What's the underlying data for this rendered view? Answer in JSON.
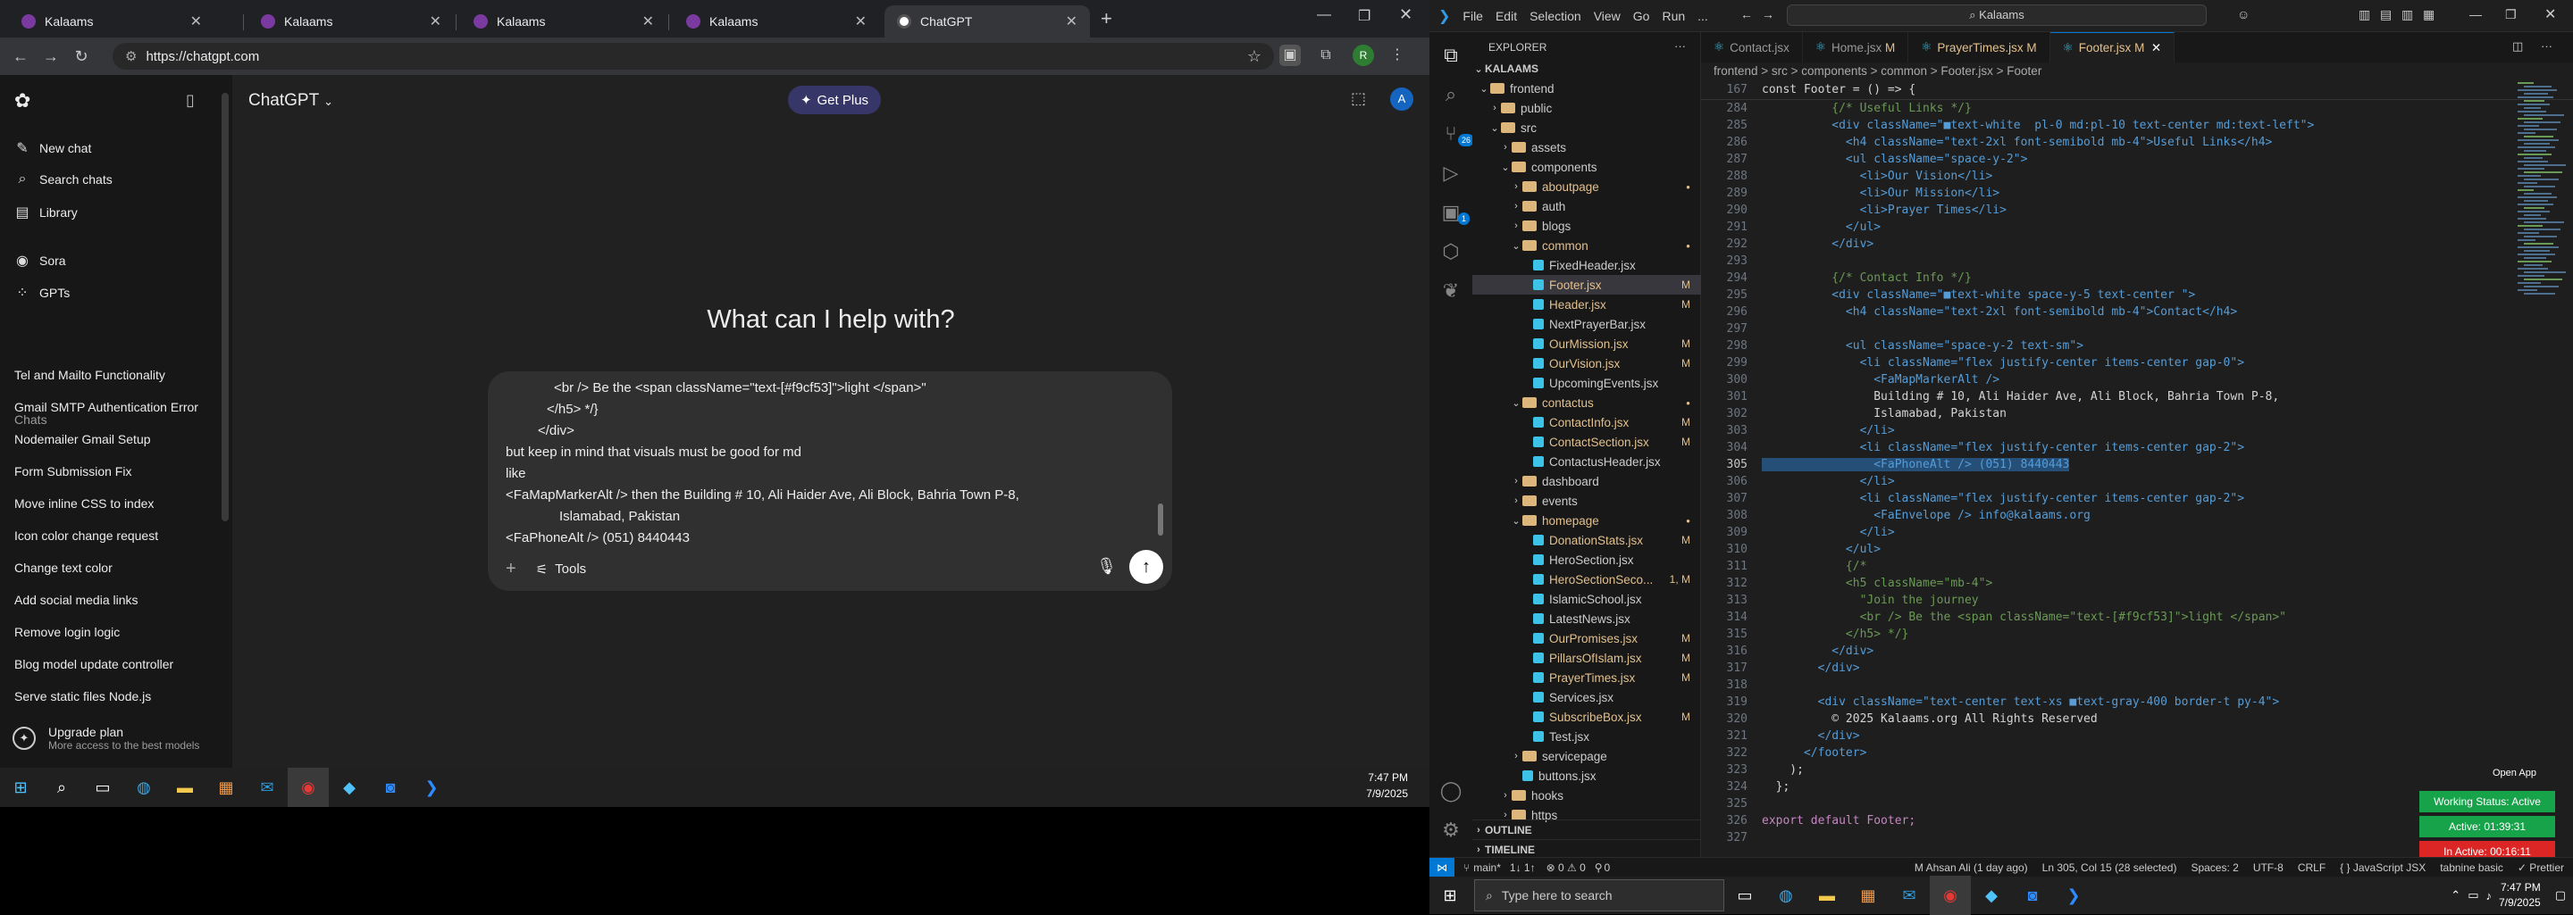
{
  "browser": {
    "tabs": [
      {
        "label": "Kalaams"
      },
      {
        "label": "Kalaams"
      },
      {
        "label": "Kalaams"
      },
      {
        "label": "Kalaams"
      },
      {
        "label": "ChatGPT"
      }
    ],
    "url": "https://chatgpt.com"
  },
  "gpt": {
    "title": "ChatGPT",
    "get_plus": "Get Plus",
    "nav": [
      {
        "label": "New chat",
        "icon": "new-chat-icon"
      },
      {
        "label": "Search chats",
        "icon": "search-icon"
      },
      {
        "label": "Library",
        "icon": "library-icon"
      },
      {
        "label": "Sora",
        "icon": "sora-icon"
      },
      {
        "label": "GPTs",
        "icon": "gpts-icon"
      }
    ],
    "chats_label": "Chats",
    "chats": [
      "Tel and Mailto Functionality",
      "Gmail SMTP Authentication Error",
      "Nodemailer Gmail Setup",
      "Form Submission Fix",
      "Move inline CSS to index",
      "Icon color change request",
      "Change text color",
      "Add social media links",
      "Remove login logic",
      "Blog model update controller",
      "Serve static files Node.js"
    ],
    "upgrade_title": "Upgrade plan",
    "upgrade_sub": "More access to the best models",
    "heading": "What can I help with?",
    "composer_lines": [
      "<br /> Be the <span className=\"text-[#f9cf53]\">light </span>\"",
      "</h5> */}",
      "</div>",
      "but keep in mind that visuals must be good for md",
      "like",
      "<FaMapMarkerAlt /> then the Building # 10, Ali Haider Ave, Ali Block, Bahria Town P-8,",
      "Islamabad, Pakistan",
      "<FaPhoneAlt /> (051) 8440443"
    ],
    "tools_label": "Tools"
  },
  "taskbar_left": {
    "time": "7:47 PM",
    "date": "7/9/2025"
  },
  "vscode": {
    "menu": [
      "File",
      "Edit",
      "Selection",
      "View",
      "Go",
      "Run",
      "..."
    ],
    "command_center": "Kalaams",
    "explorer_label": "EXPLORER",
    "workspace": "KALAAMS",
    "tree": [
      {
        "label": "frontend",
        "indent": 1,
        "type": "folder",
        "open": true
      },
      {
        "label": "public",
        "indent": 2,
        "type": "folder"
      },
      {
        "label": "src",
        "indent": 2,
        "type": "folder",
        "open": true
      },
      {
        "label": "assets",
        "indent": 3,
        "type": "folder"
      },
      {
        "label": "components",
        "indent": 3,
        "type": "folder",
        "open": true
      },
      {
        "label": "aboutpage",
        "indent": 4,
        "type": "folder",
        "mod": true
      },
      {
        "label": "auth",
        "indent": 4,
        "type": "folder"
      },
      {
        "label": "blogs",
        "indent": 4,
        "type": "folder"
      },
      {
        "label": "common",
        "indent": 4,
        "type": "folder",
        "open": true,
        "mod": true
      },
      {
        "label": "FixedHeader.jsx",
        "indent": 5,
        "type": "file"
      },
      {
        "label": "Footer.jsx",
        "indent": 5,
        "type": "file",
        "status": "M",
        "selected": true
      },
      {
        "label": "Header.jsx",
        "indent": 5,
        "type": "file",
        "status": "M"
      },
      {
        "label": "NextPrayerBar.jsx",
        "indent": 5,
        "type": "file"
      },
      {
        "label": "OurMission.jsx",
        "indent": 5,
        "type": "file",
        "status": "M"
      },
      {
        "label": "OurVision.jsx",
        "indent": 5,
        "type": "file",
        "status": "M"
      },
      {
        "label": "UpcomingEvents.jsx",
        "indent": 5,
        "type": "file"
      },
      {
        "label": "contactus",
        "indent": 4,
        "type": "folder",
        "open": true,
        "mod": true
      },
      {
        "label": "ContactInfo.jsx",
        "indent": 5,
        "type": "file",
        "status": "M"
      },
      {
        "label": "ContactSection.jsx",
        "indent": 5,
        "type": "file",
        "status": "M"
      },
      {
        "label": "ContactusHeader.jsx",
        "indent": 5,
        "type": "file"
      },
      {
        "label": "dashboard",
        "indent": 4,
        "type": "folder"
      },
      {
        "label": "events",
        "indent": 4,
        "type": "folder"
      },
      {
        "label": "homepage",
        "indent": 4,
        "type": "folder",
        "open": true,
        "mod": true
      },
      {
        "label": "DonationStats.jsx",
        "indent": 5,
        "type": "file",
        "status": "M"
      },
      {
        "label": "HeroSection.jsx",
        "indent": 5,
        "type": "file"
      },
      {
        "label": "HeroSectionSeco...",
        "indent": 5,
        "type": "file",
        "status": "1, M"
      },
      {
        "label": "IslamicSchool.jsx",
        "indent": 5,
        "type": "file"
      },
      {
        "label": "LatestNews.jsx",
        "indent": 5,
        "type": "file"
      },
      {
        "label": "OurPromises.jsx",
        "indent": 5,
        "type": "file",
        "status": "M"
      },
      {
        "label": "PillarsOfIslam.jsx",
        "indent": 5,
        "type": "file",
        "status": "M"
      },
      {
        "label": "PrayerTimes.jsx",
        "indent": 5,
        "type": "file",
        "status": "M"
      },
      {
        "label": "Services.jsx",
        "indent": 5,
        "type": "file"
      },
      {
        "label": "SubscribeBox.jsx",
        "indent": 5,
        "type": "file",
        "status": "M"
      },
      {
        "label": "Test.jsx",
        "indent": 5,
        "type": "file"
      },
      {
        "label": "servicepage",
        "indent": 4,
        "type": "folder"
      },
      {
        "label": "buttons.jsx",
        "indent": 4,
        "type": "file"
      },
      {
        "label": "hooks",
        "indent": 3,
        "type": "folder"
      },
      {
        "label": "https",
        "indent": 3,
        "type": "folder"
      }
    ],
    "outline_label": "OUTLINE",
    "timeline_label": "TIMELINE",
    "tabs": [
      {
        "label": "Contact.jsx",
        "status": ""
      },
      {
        "label": "Home.jsx",
        "status": "M"
      },
      {
        "label": "PrayerTimes.jsx",
        "status": "M"
      },
      {
        "label": "Footer.jsx",
        "status": "M",
        "active": true
      }
    ],
    "breadcrumb": "frontend > src > components > common > Footer.jsx > Footer",
    "sticky_ln": "167",
    "sticky_code": "const Footer = () => {",
    "code": [
      {
        "ln": "284",
        "t": "          {/* Useful Links */}"
      },
      {
        "ln": "285",
        "t": "          <div className=\"■text-white  pl-0 md:pl-10 text-center md:text-left\">"
      },
      {
        "ln": "286",
        "t": "            <h4 className=\"text-2xl font-semibold mb-4\">Useful Links</h4>"
      },
      {
        "ln": "287",
        "t": "            <ul className=\"space-y-2\">"
      },
      {
        "ln": "288",
        "t": "              <li>Our Vision</li>"
      },
      {
        "ln": "289",
        "t": "              <li>Our Mission</li>"
      },
      {
        "ln": "290",
        "t": "              <li>Prayer Times</li>"
      },
      {
        "ln": "291",
        "t": "            </ul>"
      },
      {
        "ln": "292",
        "t": "          </div>"
      },
      {
        "ln": "293",
        "t": ""
      },
      {
        "ln": "294",
        "t": "          {/* Contact Info */}"
      },
      {
        "ln": "295",
        "t": "          <div className=\"■text-white space-y-5 text-center \">"
      },
      {
        "ln": "296",
        "t": "            <h4 className=\"text-2xl font-semibold mb-4\">Contact</h4>"
      },
      {
        "ln": "297",
        "t": ""
      },
      {
        "ln": "298",
        "t": "            <ul className=\"space-y-2 text-sm\">"
      },
      {
        "ln": "299",
        "t": "              <li className=\"flex justify-center items-center gap-0\">"
      },
      {
        "ln": "300",
        "t": "                <FaMapMarkerAlt />"
      },
      {
        "ln": "301",
        "t": "                Building # 10, Ali Haider Ave, Ali Block, Bahria Town P-8,"
      },
      {
        "ln": "302",
        "t": "                Islamabad, Pakistan"
      },
      {
        "ln": "303",
        "t": "              </li>"
      },
      {
        "ln": "304",
        "t": "              <li className=\"flex justify-center items-center gap-2\">"
      },
      {
        "ln": "305",
        "t": "                <FaPhoneAlt /> (051) 8440443",
        "current": true
      },
      {
        "ln": "306",
        "t": "              </li>"
      },
      {
        "ln": "307",
        "t": "              <li className=\"flex justify-center items-center gap-2\">"
      },
      {
        "ln": "308",
        "t": "                <FaEnvelope /> info@kalaams.org"
      },
      {
        "ln": "309",
        "t": "              </li>"
      },
      {
        "ln": "310",
        "t": "            </ul>"
      },
      {
        "ln": "311",
        "t": "            {/*"
      },
      {
        "ln": "312",
        "t": "            <h5 className=\"mb-4\">"
      },
      {
        "ln": "313",
        "t": "              \"Join the journey"
      },
      {
        "ln": "314",
        "t": "              <br /> Be the <span className=\"text-[#f9cf53]\">light </span>\""
      },
      {
        "ln": "315",
        "t": "            </h5> */}"
      },
      {
        "ln": "316",
        "t": "          </div>"
      },
      {
        "ln": "317",
        "t": "        </div>"
      },
      {
        "ln": "318",
        "t": ""
      },
      {
        "ln": "319",
        "t": "        <div className=\"text-center text-xs ■text-gray-400 border-t py-4\">"
      },
      {
        "ln": "320",
        "t": "          © 2025 Kalaams.org All Rights Reserved"
      },
      {
        "ln": "321",
        "t": "        </div>"
      },
      {
        "ln": "322",
        "t": "      </footer>"
      },
      {
        "ln": "323",
        "t": "    );"
      },
      {
        "ln": "324",
        "t": "  };"
      },
      {
        "ln": "325",
        "t": ""
      },
      {
        "ln": "326",
        "t": "export default Footer;"
      },
      {
        "ln": "327",
        "t": ""
      }
    ],
    "open_app": "Open App",
    "working_status": "Working Status: Active",
    "active_time": "Active: 01:39:31",
    "inactive_time": "In Active: 00:16:11",
    "status": {
      "branch": "main*",
      "sync": "1↓ 1↑",
      "problems": "⊗ 0 ⚠ 0",
      "ports": "0",
      "blame": "M Ahsan Ali (1 day ago)",
      "position": "Ln 305, Col 15 (28 selected)",
      "spaces": "Spaces: 2",
      "encoding": "UTF-8",
      "eol": "CRLF",
      "language": "{ } JavaScript JSX",
      "tabnine": "tabnine basic",
      "prettier": "✓ Prettier"
    }
  },
  "taskbar_right": {
    "search_placeholder": "Type here to search",
    "time": "7:47 PM",
    "date": "7/9/2025"
  },
  "colors": {
    "accent": "#0078d4",
    "green": "#16a34a",
    "red": "#dc2626",
    "plus": "#373669"
  }
}
